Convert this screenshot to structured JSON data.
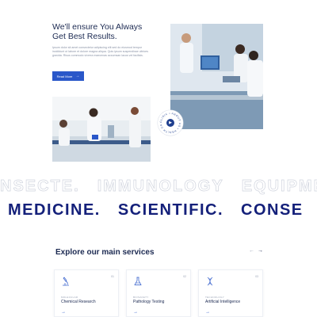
{
  "hero": {
    "title": "We'll ensure You Always Get Best Results.",
    "text": "Ipsum dolor sit amet consectetur adipiscing elit sed do eiusmod tempor incididunt ut labore et dolore magna aliqua. Quis ipsum suspendisse ultrices gravida. Risus commodo viverra maecenas accumsan lacus vel facilisis.",
    "button_label": "Read More",
    "button_arrow": "→",
    "badge_text": "CLINIC • ABOUT US • HEALTH CARE •",
    "badge_play": "▶"
  },
  "ticker": {
    "outline_words": [
      "NSECTE.",
      "IMMUNOLOGY",
      "EQUIPME"
    ],
    "solid_words": [
      "MEDICINE.",
      "SCIENTIFIC.",
      "CONSE"
    ]
  },
  "services": {
    "title": "Explore our main services",
    "prev_arrow": "←",
    "next_arrow": "→",
    "cards": [
      {
        "num": "01",
        "category": "Molecular",
        "name": "Chemical Research",
        "icon": "microscope-icon",
        "arrow": "→"
      },
      {
        "num": "02",
        "category": "Biosafety",
        "name": "Pathology Testing",
        "icon": "flask-icon",
        "arrow": "→"
      },
      {
        "num": "03",
        "category": "Technology",
        "name": "Artificial Intelligence",
        "icon": "dna-icon",
        "arrow": "→"
      }
    ]
  },
  "colors": {
    "accent": "#2a57c9",
    "navy": "#14207a",
    "heading": "#1c2a52"
  }
}
